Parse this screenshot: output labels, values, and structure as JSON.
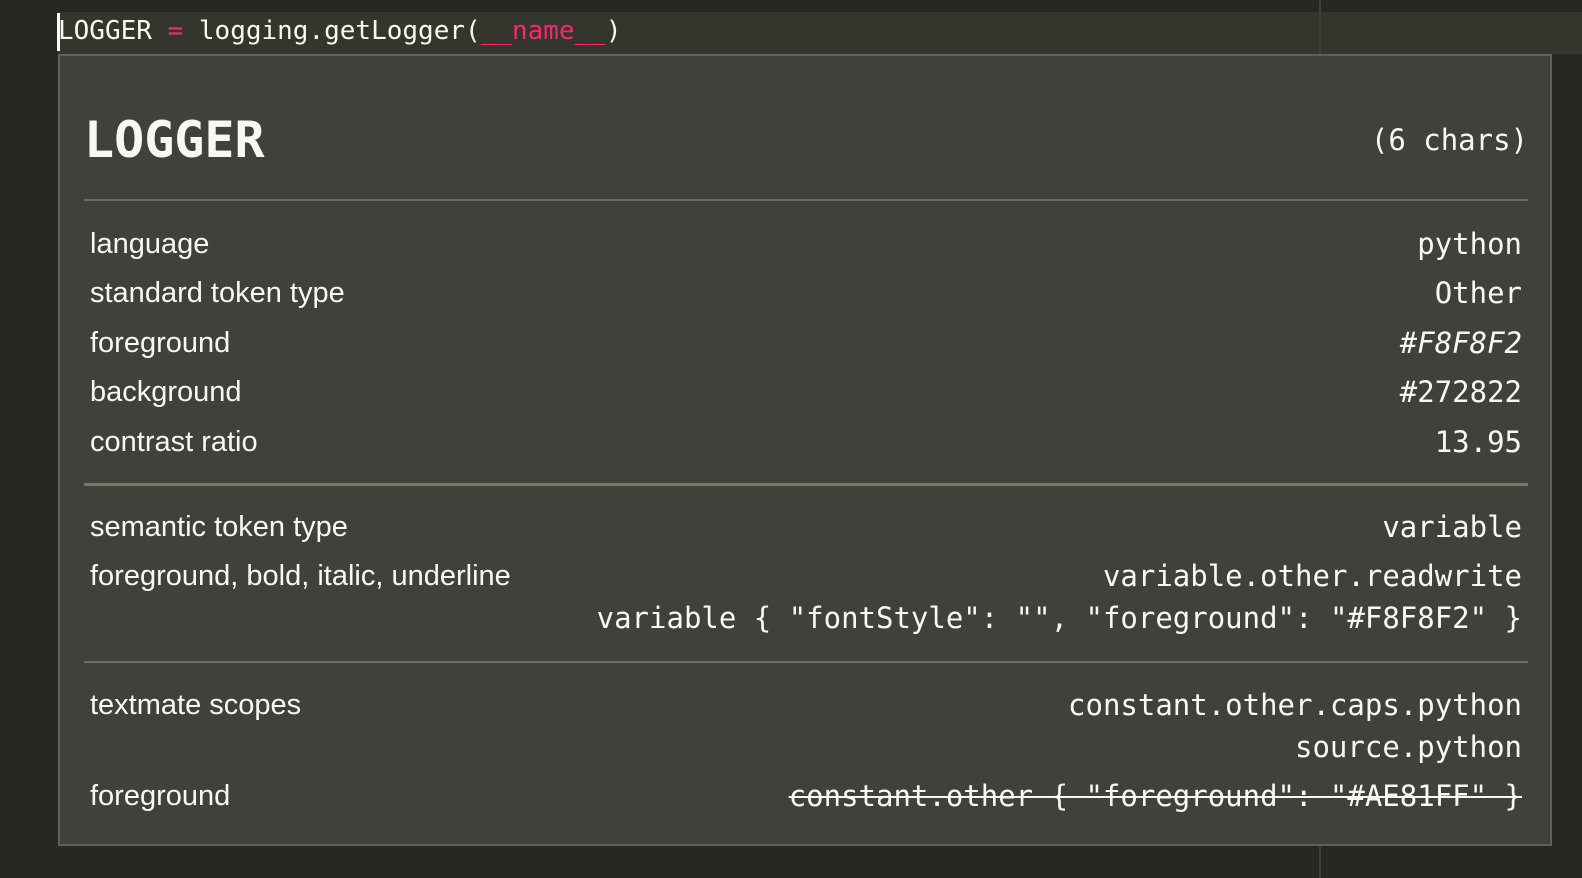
{
  "editor": {
    "code_line": {
      "identifier": "LOGGER",
      "operator": "=",
      "call_start": "logging.getLogger(",
      "dunder": "__name__",
      "call_end": ")"
    },
    "colors": {
      "background": "#262821",
      "current_line": "#34362d",
      "foreground": "#F8F8F2",
      "keyword": "#F92672",
      "hover_background": "#3e423a",
      "hover_border": "#5e6157"
    }
  },
  "hover": {
    "token": "LOGGER",
    "char_count": "(6 chars)",
    "standard": [
      {
        "label": "language",
        "value": "python"
      },
      {
        "label": "standard token type",
        "value": "Other"
      },
      {
        "label": "foreground",
        "value": "#F8F8F2"
      },
      {
        "label": "background",
        "value": "#272822"
      },
      {
        "label": "contrast ratio",
        "value": "13.95"
      }
    ],
    "semantic": {
      "type_label": "semantic token type",
      "type_value": "variable",
      "style_label": "foreground, bold, italic, underline",
      "style_value": "variable.other.readwrite",
      "style_rule": "variable { \"fontStyle\": \"\", \"foreground\": \"#F8F8F2\" }"
    },
    "textmate": {
      "scopes_label": "textmate scopes",
      "scopes": [
        "constant.other.caps.python",
        "source.python"
      ],
      "foreground_label": "foreground",
      "foreground_rule": "constant.other { \"foreground\": \"#AE81FF\" }"
    }
  }
}
